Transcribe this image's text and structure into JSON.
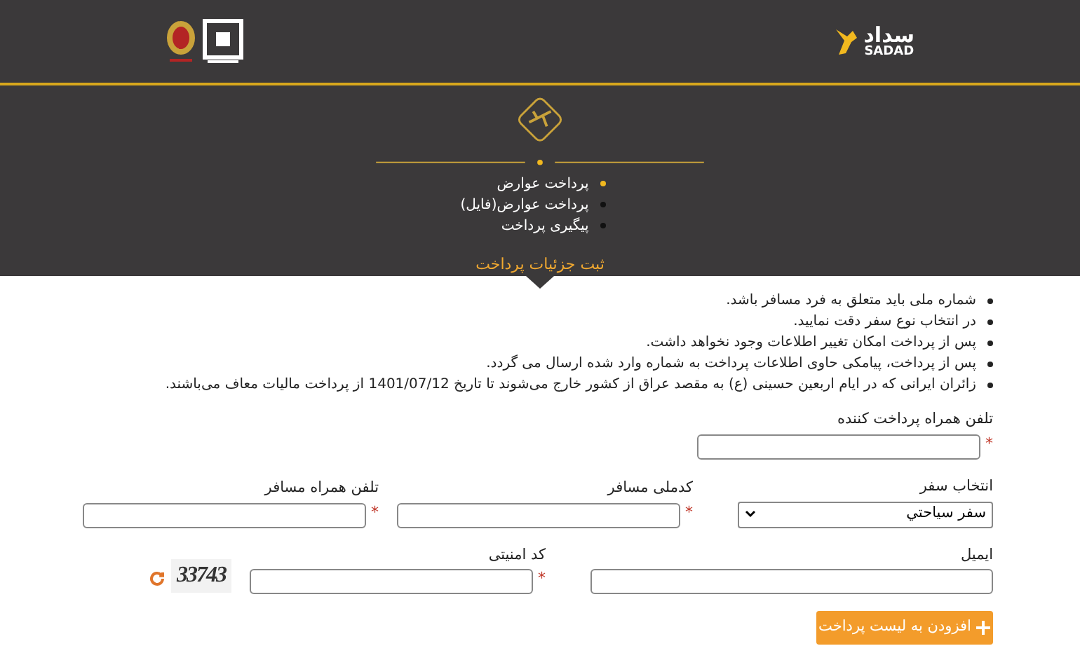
{
  "header": {
    "logo_text": "سداد",
    "logo_latin": "SADAD"
  },
  "menu": [
    {
      "label": "پرداخت عوارض",
      "selected": true
    },
    {
      "label": "پرداخت عوارض(فایل)",
      "selected": false
    },
    {
      "label": "پیگیری پرداخت",
      "selected": false
    }
  ],
  "section_title": "ثبت جزئیات پرداخت",
  "notes": [
    "شماره ملی باید متعلق به فرد مسافر باشد.",
    "در انتخاب نوع سفر دقت نمایید.",
    "پس از پرداخت امکان تغییر اطلاعات وجود نخواهد داشت.",
    "پس از پرداخت، پیامکی حاوی اطلاعات پرداخت به شماره وارد شده ارسال می گردد.",
    "زائران ایرانی که در ایام اربعین حسینی (ع) به مقصد عراق از کشور خارج می‌شوند تا تاریخ 1401/07/12 از پرداخت مالیات معاف می‌باشند."
  ],
  "form": {
    "rows": [
      [
        {
          "kind": "input",
          "label": "تلفن همراه پرداخت کننده",
          "required_mark": "*"
        }
      ],
      [
        {
          "kind": "select",
          "label": "انتخاب سفر",
          "value": "سفر سیاحتي"
        },
        {
          "kind": "input",
          "label": "کدملی مسافر",
          "required_mark": "*"
        },
        {
          "kind": "input",
          "label": "تلفن همراه مسافر",
          "required_mark": "*"
        }
      ],
      [
        {
          "kind": "wide",
          "label": "ایمیل"
        },
        {
          "kind": "input",
          "label": "کد امنیتی",
          "required_mark": "*"
        },
        {
          "kind": "captcha",
          "text": "33743"
        }
      ]
    ]
  },
  "submit_button": {
    "label": "افزودن به لیست پرداخت"
  }
}
